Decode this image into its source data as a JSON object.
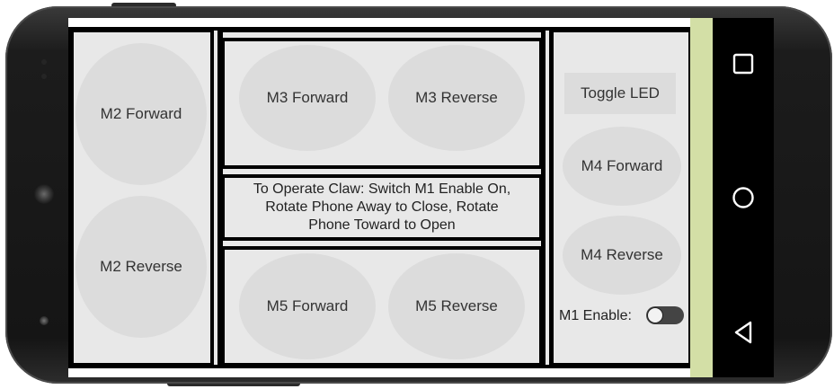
{
  "controls": {
    "m2_forward": "M2 Forward",
    "m2_reverse": "M2 Reverse",
    "m3_forward": "M3 Forward",
    "m3_reverse": "M3 Reverse",
    "m5_forward": "M5 Forward",
    "m5_reverse": "M5 Reverse",
    "m4_forward": "M4 Forward",
    "m4_reverse": "M4 Reverse",
    "toggle_led": "Toggle LED"
  },
  "instructions": {
    "line1": "To Operate Claw: Switch M1 Enable On,",
    "line2": "Rotate Phone Away to Close, Rotate",
    "line3": "Phone Toward to Open"
  },
  "m1_enable": {
    "label": "M1 Enable:",
    "state": "off"
  },
  "android_nav": [
    "recents-button",
    "home-button",
    "back-button"
  ],
  "colors": {
    "panel_bg": "#e8e8e8",
    "button_bg": "#dcdcdc",
    "accent_strip": "#d3dfa6",
    "phone_body": "#1c1c1c"
  }
}
